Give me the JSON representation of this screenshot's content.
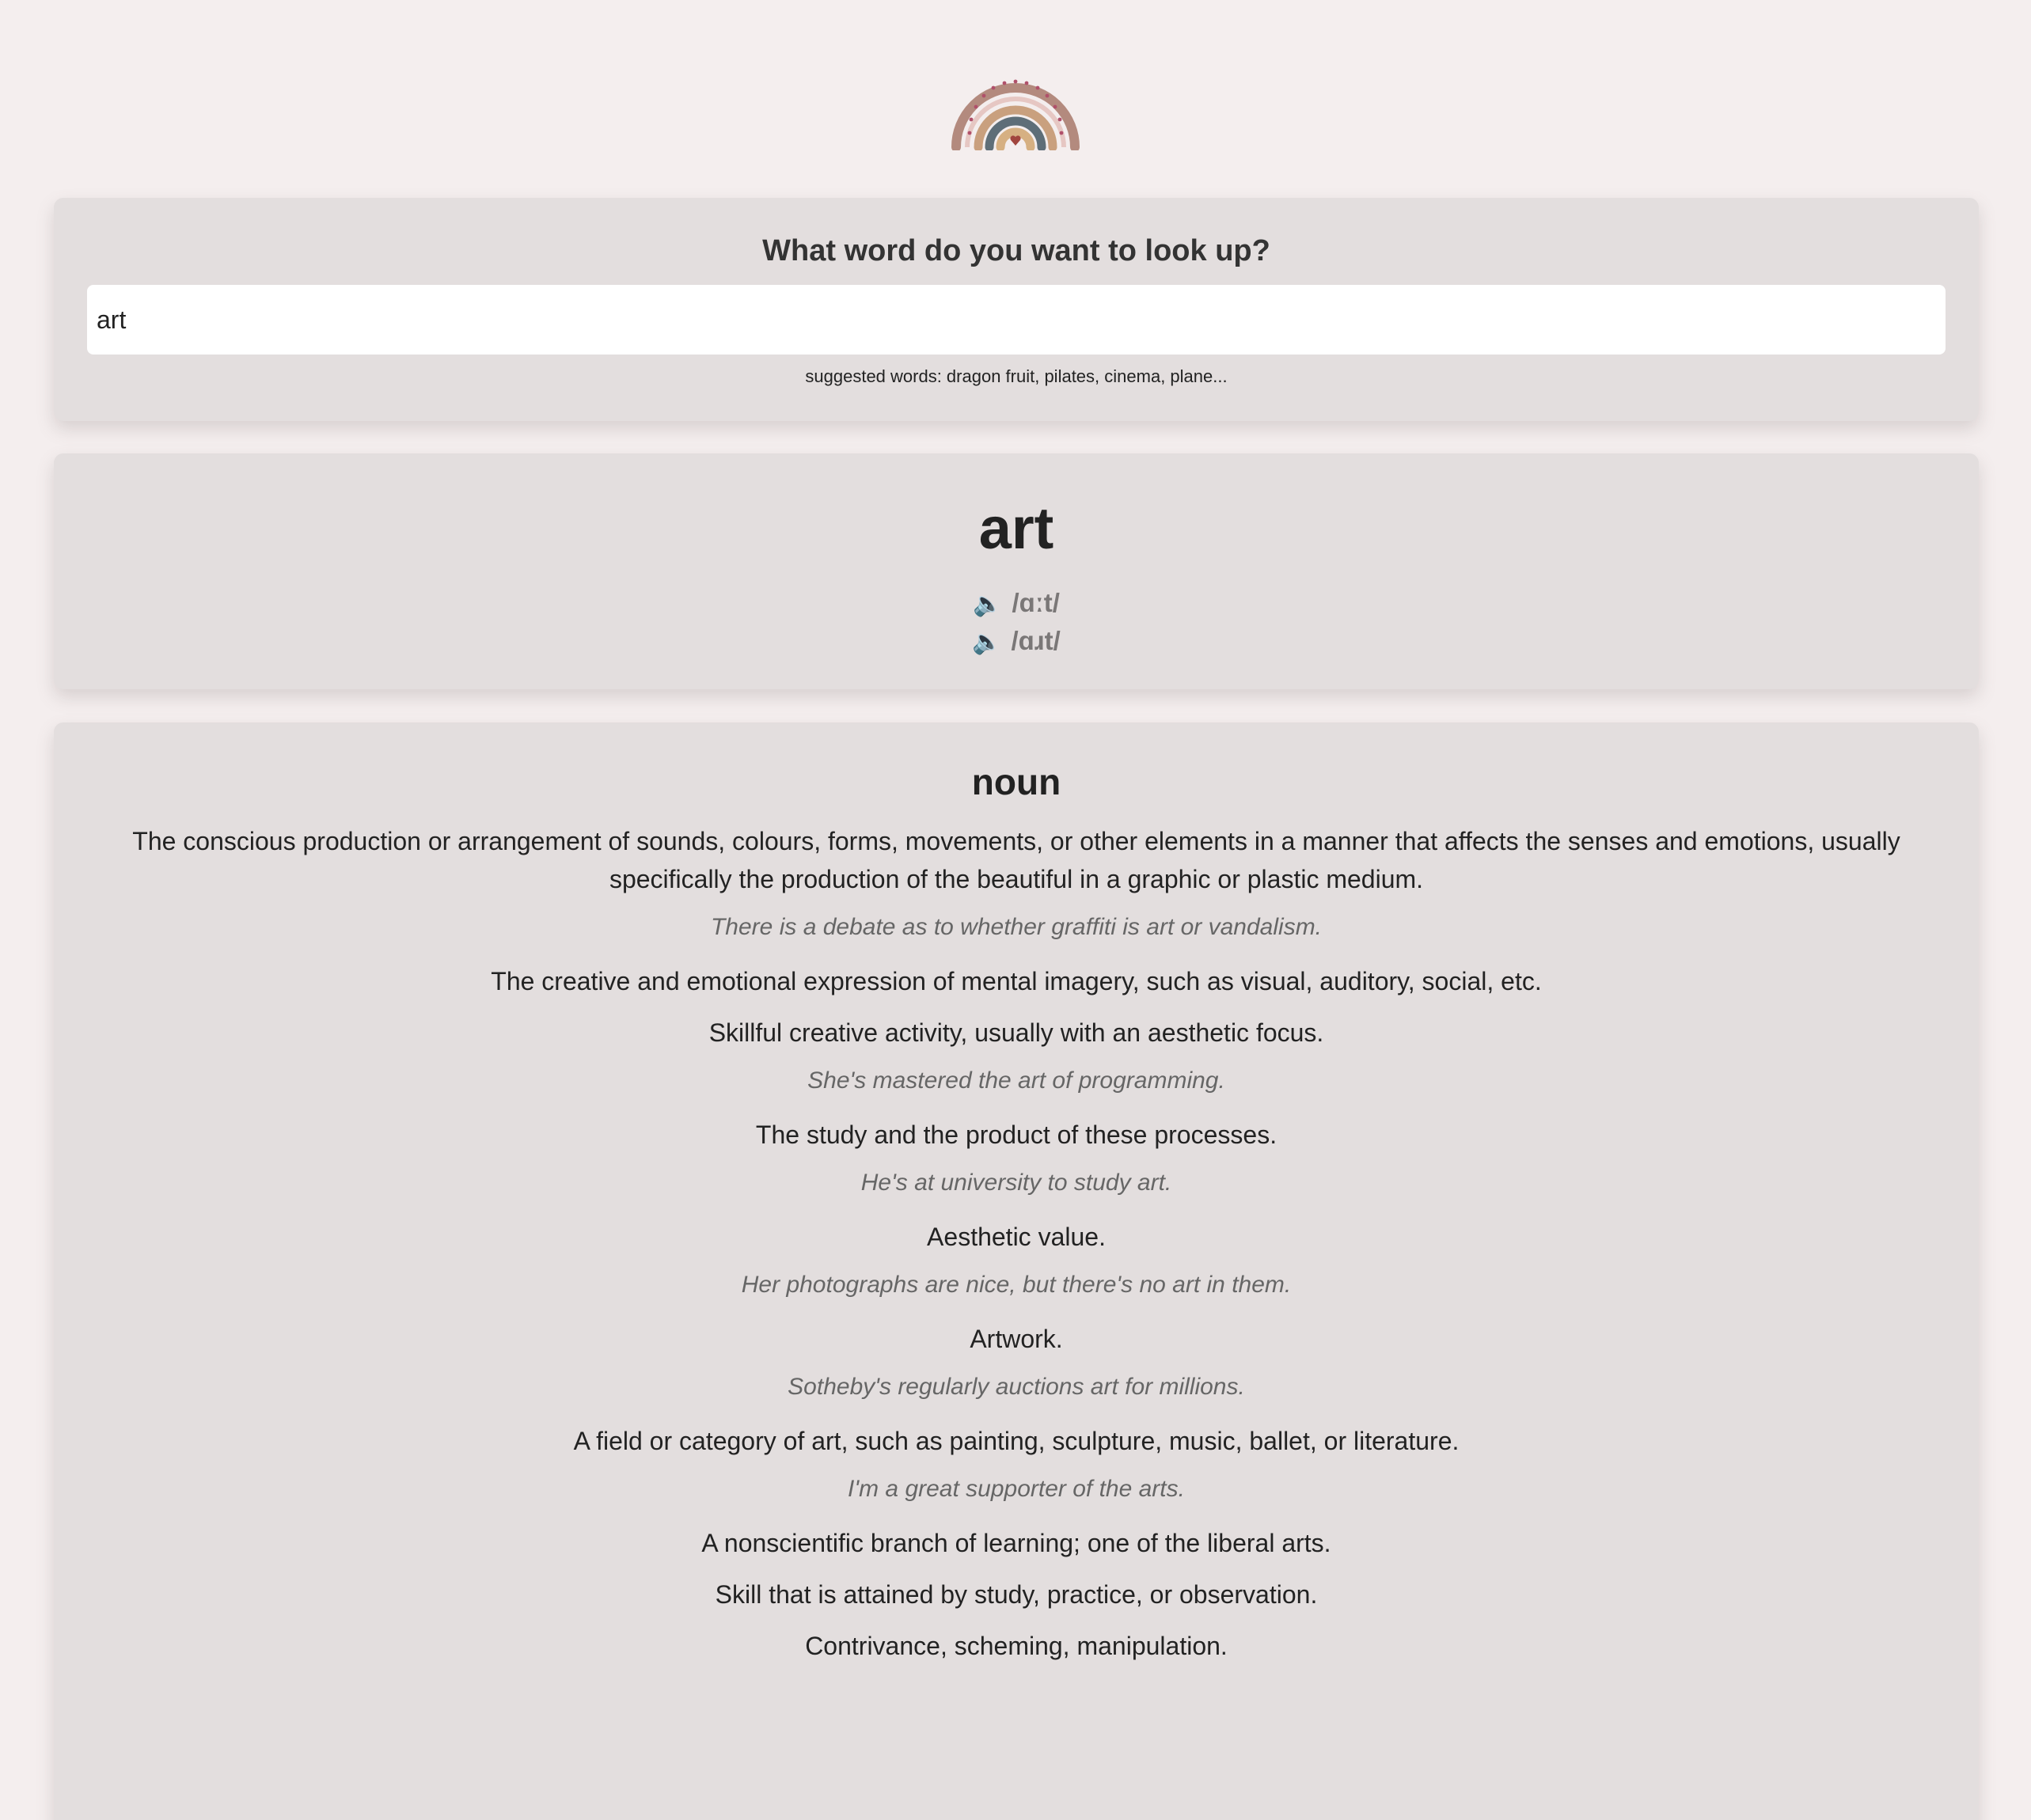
{
  "search": {
    "title": "What word do you want to look up?",
    "value": "art",
    "suggestions": "suggested words: dragon fruit, pilates, cinema, plane..."
  },
  "word": {
    "title": "art",
    "phonetics": [
      {
        "icon": "speaker-icon",
        "text": "/ɑːt/"
      },
      {
        "icon": "speaker-icon",
        "text": "/ɑɹt/"
      }
    ]
  },
  "meaning": {
    "part_of_speech": "noun",
    "definitions": [
      {
        "text": "The conscious production or arrangement of sounds, colours, forms, movements, or other elements in a manner that affects the senses and emotions, usually specifically the production of the beautiful in a graphic or plastic medium.",
        "example": "There is a debate as to whether graffiti is art or vandalism."
      },
      {
        "text": "The creative and emotional expression of mental imagery, such as visual, auditory, social, etc.",
        "example": ""
      },
      {
        "text": "Skillful creative activity, usually with an aesthetic focus.",
        "example": "She's mastered the art of programming."
      },
      {
        "text": "The study and the product of these processes.",
        "example": "He's at university to study art."
      },
      {
        "text": "Aesthetic value.",
        "example": "Her photographs are nice, but there's no art in them."
      },
      {
        "text": "Artwork.",
        "example": "Sotheby's regularly auctions art for millions."
      },
      {
        "text": "A field or category of art, such as painting, sculpture, music, ballet, or literature.",
        "example": "I'm a great supporter of the arts."
      },
      {
        "text": "A nonscientific branch of learning; one of the liberal arts.",
        "example": ""
      },
      {
        "text": "Skill that is attained by study, practice, or observation.",
        "example": ""
      },
      {
        "text": "Contrivance, scheming, manipulation.",
        "example": ""
      }
    ]
  },
  "colors": {
    "background": "#f4eeee",
    "card": "#e3dede",
    "rainbow_outer": "#b38a7e",
    "rainbow_pink": "#d9a6a2",
    "rainbow_tan": "#c9a07e",
    "rainbow_slate": "#5e6e78",
    "rainbow_inner": "#d6b082",
    "heart": "#a1453e"
  }
}
